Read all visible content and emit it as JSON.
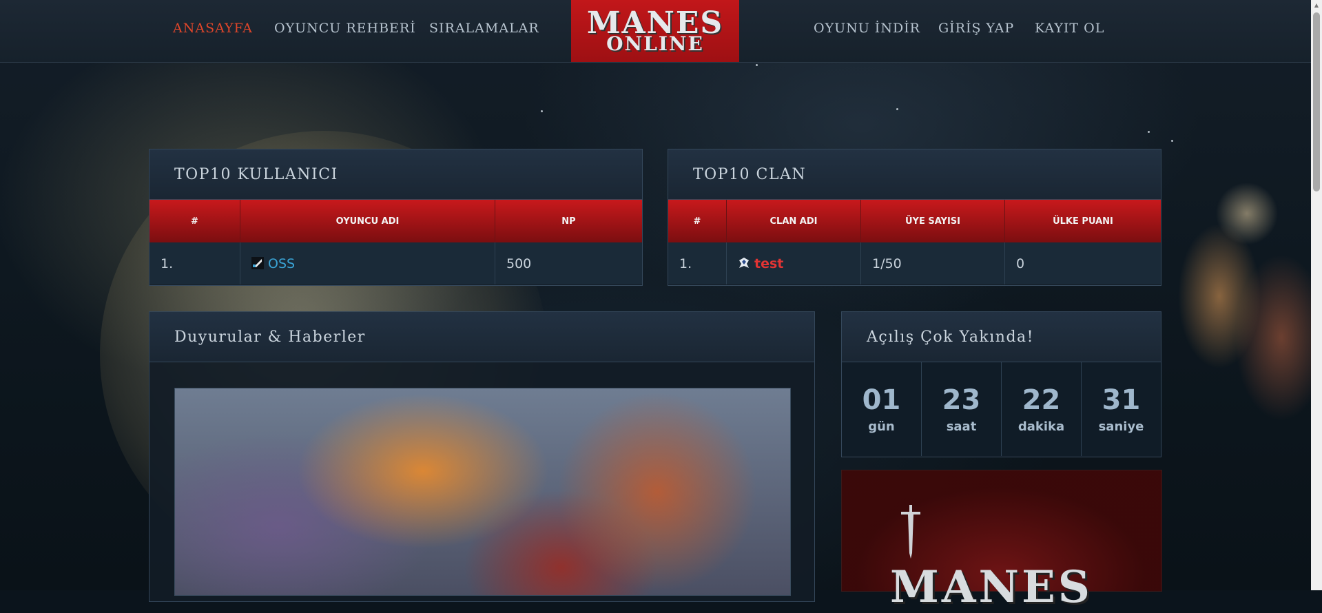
{
  "nav": {
    "left": [
      {
        "label": "ANASAYFA",
        "active": true
      },
      {
        "label": "OYUNCU REHBERİ",
        "active": false
      },
      {
        "label": "SIRALAMALAR",
        "active": false
      }
    ],
    "right": [
      {
        "label": "OYUNU İNDİR"
      },
      {
        "label": "GİRİŞ YAP"
      },
      {
        "label": "KAYIT OL"
      }
    ],
    "logo_line1": "MANES",
    "logo_line2": "ONLINE"
  },
  "top_users": {
    "title": "TOP10 KULLANICI",
    "columns": [
      "#",
      "OYUNCU ADI",
      "NP"
    ],
    "rows": [
      {
        "rank": "1.",
        "name": "OSS",
        "np": "500"
      }
    ]
  },
  "top_clans": {
    "title": "TOP10 CLAN",
    "columns": [
      "#",
      "CLAN ADI",
      "ÜYE SAYISI",
      "ÜLKE PUANI"
    ],
    "rows": [
      {
        "rank": "1.",
        "name": "test",
        "members": "1/50",
        "points": "0"
      }
    ]
  },
  "news": {
    "title": "Duyurular & Haberler"
  },
  "countdown": {
    "title": "Açılış Çok Yakında!",
    "units": [
      {
        "value": "01",
        "label": "gün"
      },
      {
        "value": "23",
        "label": "saat"
      },
      {
        "value": "22",
        "label": "dakika"
      },
      {
        "value": "31",
        "label": "saniye"
      }
    ]
  },
  "promo": {
    "logo_text": "MANES"
  },
  "colors": {
    "accent_red": "#c8191c",
    "active_nav": "#e0462a",
    "player_link": "#3aa4d6",
    "clan_link": "#e23434"
  }
}
